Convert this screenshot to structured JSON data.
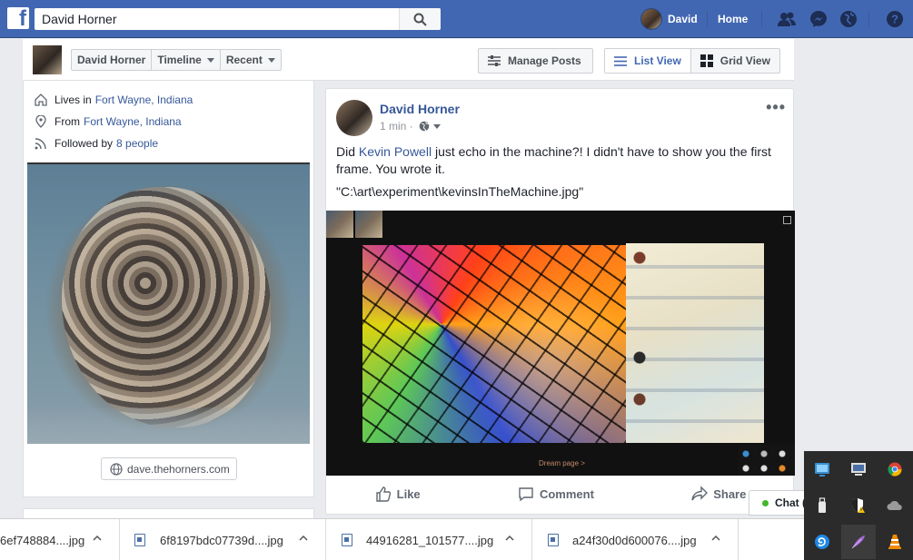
{
  "topbar": {
    "search_value": "David Horner",
    "user_name": "David",
    "home_label": "Home"
  },
  "subheader": {
    "name_tab": "David Horner",
    "timeline_tab": "Timeline",
    "recent_tab": "Recent",
    "manage_posts": "Manage Posts",
    "list_view": "List View",
    "grid_view": "Grid View"
  },
  "intro": {
    "lives_prefix": "Lives in",
    "lives_link": "Fort Wayne, Indiana",
    "from_prefix": "From",
    "from_link": "Fort Wayne, Indiana",
    "followed_prefix": "Followed by",
    "followed_link": "8 people",
    "website": "dave.thehorners.com"
  },
  "post": {
    "author": "David Horner",
    "time": "1 min ·",
    "text_before": "Did ",
    "mention": "Kevin Powell",
    "text_after": " just echo in the machine?! I didn't have to show you the first frame. You wrote it.",
    "path": "\"C:\\art\\experiment\\kevinsInTheMachine.jpg\"",
    "image_caption": "Dream page >",
    "like": "Like",
    "comment": "Comment",
    "share": "Share"
  },
  "chat": {
    "label": "Chat ("
  },
  "downloads": [
    {
      "name": "6ef748884....jpg"
    },
    {
      "name": "6f8197bdc07739d....jpg"
    },
    {
      "name": "44916281_101577....jpg"
    },
    {
      "name": "a24f30d0d600076....jpg"
    }
  ],
  "colors": {
    "facebook_blue": "#4267b2",
    "link_blue": "#365899",
    "online_green": "#42b72a"
  }
}
